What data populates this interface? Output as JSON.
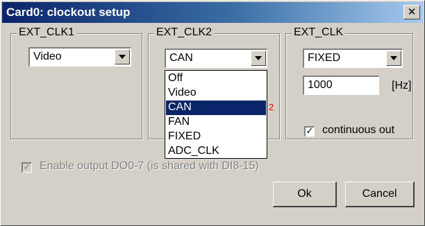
{
  "window": {
    "title": "Card0: clockout setup",
    "close_glyph": "✕"
  },
  "groups": {
    "ext_clk1": {
      "label": "EXT_CLK1",
      "value": "Video"
    },
    "ext_clk2": {
      "label": "EXT_CLK2",
      "value": "CAN"
    },
    "ext_clk": {
      "label": "EXT_CLK",
      "value": "FIXED",
      "frequency": "1000",
      "unit": "[Hz]",
      "continuous_label": "continuous out",
      "continuous_checked": true
    }
  },
  "dropdown": {
    "options": [
      "Off",
      "Video",
      "CAN",
      "FAN",
      "FIXED",
      "ADC_CLK"
    ],
    "selected": "CAN",
    "stray_mark": "2"
  },
  "enable_output": {
    "label": "Enable output DO0-7 (is shared with DI8-15)",
    "checked": true,
    "disabled": true
  },
  "buttons": {
    "ok": "Ok",
    "cancel": "Cancel"
  },
  "icons": {
    "checkmark": "check-icon",
    "close": "close-icon",
    "dropdown_arrow": "chevron-down-icon"
  }
}
